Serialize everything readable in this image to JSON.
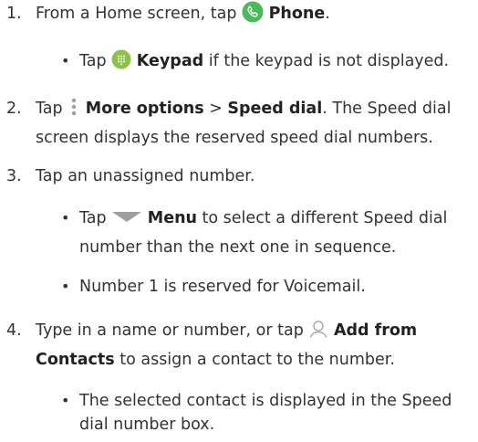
{
  "steps": [
    {
      "number": "1.",
      "pre": "From a Home screen, tap ",
      "bold": "Phone",
      "post": ".",
      "icon": "phone-icon",
      "bullets": [
        {
          "pre": "Tap ",
          "bold": "Keypad",
          "post": " if the keypad is not displayed.",
          "icon": "keypad-icon"
        }
      ]
    },
    {
      "number": "2.",
      "pre": "Tap ",
      "bold": "More options",
      "sep": " > ",
      "bold2": "Speed dial",
      "post": ". The Speed dial",
      "line2": "screen displays the reserved speed dial numbers.",
      "icon": "more-options-icon"
    },
    {
      "number": "3.",
      "text": "Tap an unassigned number.",
      "bullets": [
        {
          "pre": "Tap ",
          "bold": "Menu",
          "post": " to select a different Speed dial",
          "line2": "number than the next one in sequence.",
          "icon": "menu-triangle-icon"
        },
        {
          "text": "Number 1 is reserved for Voicemail."
        }
      ]
    },
    {
      "number": "4.",
      "pre": "Type in a name or number, or tap ",
      "bold": "Add from",
      "line2_bold": "Contacts",
      "line2_post": " to assign a contact to the number.",
      "icon": "add-contact-icon",
      "bullets": [
        {
          "text": "The selected contact is displayed in the Speed",
          "line2": "dial number box."
        }
      ]
    }
  ],
  "bullet_char": "•",
  "colors": {
    "text": "#333333",
    "phone_icon": "#4cba5a",
    "keypad_icon": "#8bc34a",
    "icon_gray": "#9e9e9e"
  }
}
